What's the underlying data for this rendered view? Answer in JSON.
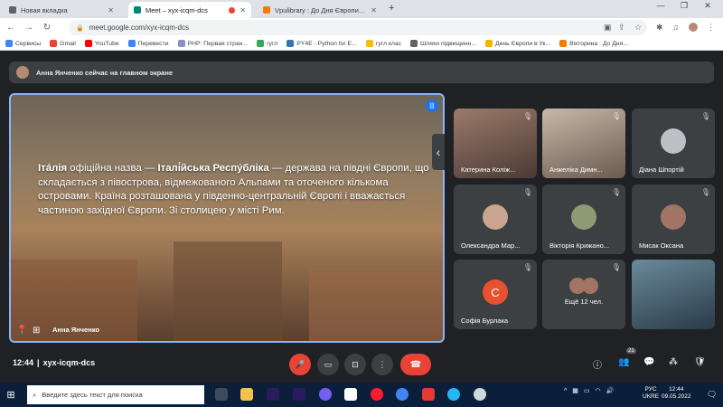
{
  "browser": {
    "tabs": [
      {
        "title": "Новая вкладка",
        "active": false
      },
      {
        "title": "Meet – xyx-icqm-dcs",
        "active": true
      },
      {
        "title": "Vpulibrary : До Дня Європи в Укр",
        "active": false
      }
    ],
    "new_tab_symbol": "+",
    "url": "meet.google.com/xyx-icqm-dcs",
    "bookmarks": [
      "Сервисы",
      "Gmail",
      "YouTube",
      "Перевести",
      "PHP: Первая стран...",
      "гугл",
      "PY4E - Python for E...",
      "гугл клас",
      "Шляхи підвищенн...",
      "День Європи в Ук...",
      "Вікторина : До Дня..."
    ]
  },
  "meet": {
    "banner": "Анна Янченко сейчас на главном экране",
    "slide_paragraph": [
      {
        "t": "Іта́лія",
        "b": true
      },
      {
        "t": " офіційна назва — ",
        "b": false
      },
      {
        "t": "Італі́йська Респу́бліка",
        "b": true
      },
      {
        "t": " — держава на півдні Європи, що складається з півострова, відмежованого Альпами та оточеного кількома островами. Країна розташована у південно-центральній Європі і вважається частиною західної Європи. Зі столицею у місті Рим.",
        "b": false
      }
    ],
    "presenter_name": "Анна Янченко",
    "participants": [
      {
        "name": "Катерина Коліж...",
        "style": "video"
      },
      {
        "name": "Анжеліка Димн...",
        "style": "video2"
      },
      {
        "name": "Діана Шпортій",
        "style": "avatar",
        "avatar_color": "#bdc1c6"
      },
      {
        "name": "Олександра Мар...",
        "style": "avatar",
        "avatar_color": "#c9a58f"
      },
      {
        "name": "Вікторія Крижано...",
        "style": "avatar",
        "avatar_color": "#8d9a74"
      },
      {
        "name": "Мисак Оксана",
        "style": "avatar",
        "avatar_color": "#a17464"
      },
      {
        "name": "Софія Бурлака",
        "style": "letter",
        "letter": "С",
        "avatar_color": "#e8512d"
      },
      {
        "name": "Ещё 12 чел.",
        "style": "more"
      },
      {
        "name": "",
        "style": "video3"
      }
    ],
    "time": "12:44",
    "meeting_code": "xyx-icqm-dcs",
    "participant_count": "21"
  },
  "taskbar": {
    "search_placeholder": "Введите здесь текст для поиска",
    "lang": "РУС",
    "lang_sub": "UKRE",
    "time": "12:44",
    "date": "09.05.2022"
  },
  "colors": {
    "accent": "#8ab4f8",
    "red": "#ea4335",
    "tile": "#3c4043",
    "bg": "#202124"
  }
}
